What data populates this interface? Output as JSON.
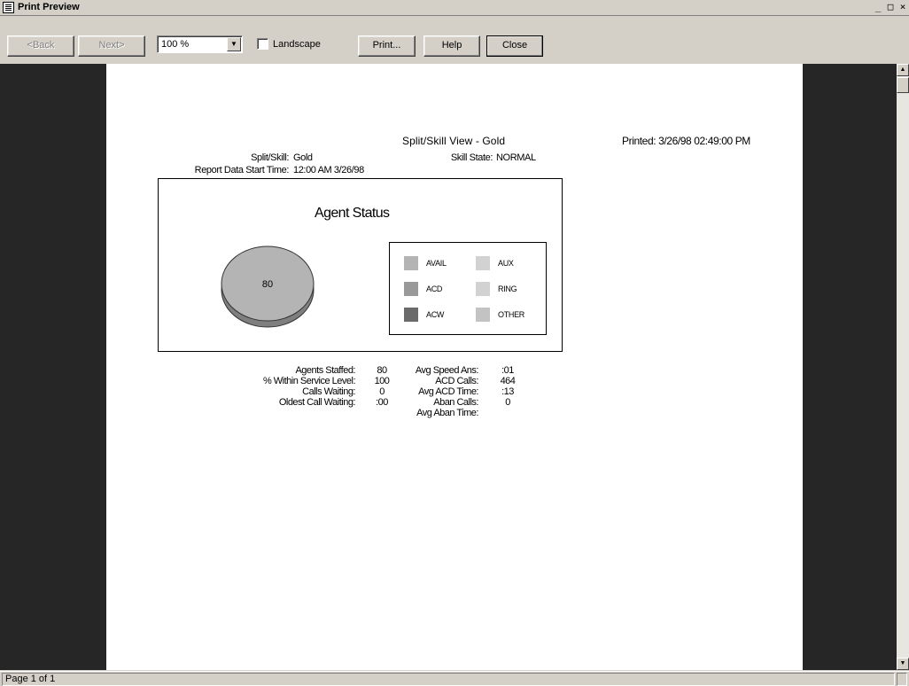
{
  "window": {
    "title": "Print Preview",
    "controls": [
      "_",
      "□",
      "×"
    ]
  },
  "toolbar": {
    "back_label": "<Back",
    "next_label": "Next>",
    "zoom_value": "100 %",
    "landscape_label": "Landscape",
    "landscape_checked": false,
    "print_label": "Print...",
    "help_label": "Help",
    "close_label": "Close"
  },
  "report": {
    "view_title": "Split/Skill View - Gold",
    "printed": "Printed: 3/26/98 02:49:00 PM",
    "split_skill_label": "Split/Skill:",
    "split_skill_value": "Gold",
    "skill_state_label": "Skill State:",
    "skill_state_value": "NORMAL",
    "start_time_label": "Report Data Start Time:",
    "start_time_value": "12:00 AM 3/26/98",
    "stats_left": [
      {
        "label": "Agents Staffed:",
        "value": "80"
      },
      {
        "label": "% Within Service Level:",
        "value": "100"
      },
      {
        "label": "Calls Waiting:",
        "value": "0"
      },
      {
        "label": "Oldest Call Waiting:",
        "value": ":00"
      }
    ],
    "stats_right": [
      {
        "label": "Avg Speed Ans:",
        "value": ":01"
      },
      {
        "label": "ACD Calls:",
        "value": "464"
      },
      {
        "label": "Avg ACD Time:",
        "value": ":13"
      },
      {
        "label": "Aban Calls:",
        "value": "0"
      },
      {
        "label": "Avg Aban Time:",
        "value": ""
      }
    ]
  },
  "chart_data": {
    "type": "pie",
    "title": "Agent Status",
    "legend_placement": "right",
    "series": [
      {
        "name": "AVAIL",
        "value": 80,
        "color": "#b4b4b4"
      },
      {
        "name": "AUX",
        "value": 0,
        "color": "#d2d2d2"
      },
      {
        "name": "ACD",
        "value": 0,
        "color": "#999999"
      },
      {
        "name": "RING",
        "value": 0,
        "color": "#d2d2d2"
      },
      {
        "name": "ACW",
        "value": 0,
        "color": "#6b6b6b"
      },
      {
        "name": "OTHER",
        "value": 0,
        "color": "#c3c3c3"
      }
    ],
    "data_labels": [
      "80"
    ]
  },
  "status": {
    "page_text": "Page 1 of 1"
  }
}
